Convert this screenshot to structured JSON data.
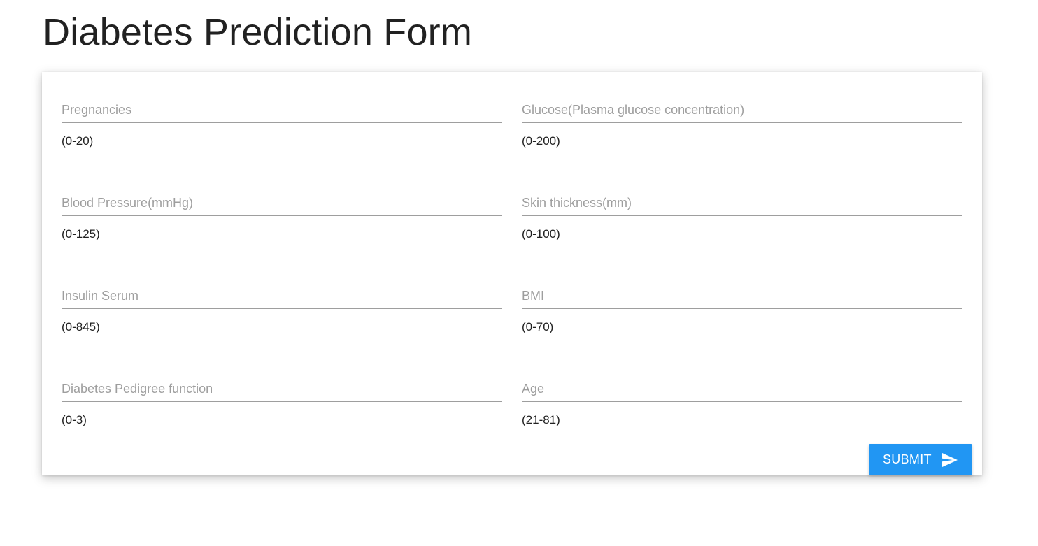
{
  "page": {
    "title": "Diabetes Prediction Form"
  },
  "form": {
    "fields": [
      {
        "placeholder": "Pregnancies",
        "value": "",
        "hint": "(0-20)"
      },
      {
        "placeholder": "Glucose(Plasma glucose concentration)",
        "value": "",
        "hint": "(0-200)"
      },
      {
        "placeholder": "Blood Pressure(mmHg)",
        "value": "",
        "hint": "(0-125)"
      },
      {
        "placeholder": "Skin thickness(mm)",
        "value": "",
        "hint": "(0-100)"
      },
      {
        "placeholder": "Insulin Serum",
        "value": "",
        "hint": "(0-845)"
      },
      {
        "placeholder": "BMI",
        "value": "",
        "hint": "(0-70)"
      },
      {
        "placeholder": "Diabetes Pedigree function",
        "value": "",
        "hint": "(0-3)"
      },
      {
        "placeholder": "Age",
        "value": "",
        "hint": "(21-81)"
      }
    ],
    "submit": {
      "label": "SUBMIT",
      "icon": "send-icon",
      "color": "#2196f3"
    }
  }
}
